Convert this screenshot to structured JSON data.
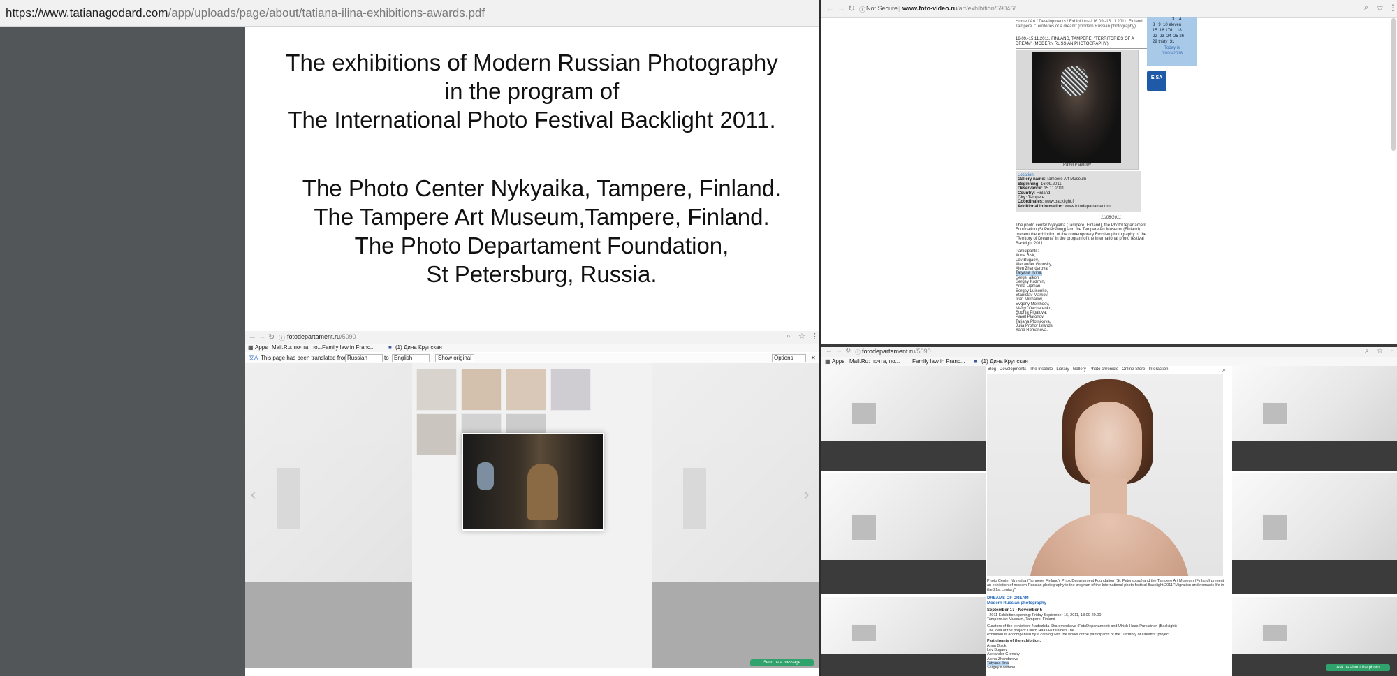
{
  "left_window": {
    "url_host": "https://www.tatianagodard.com",
    "url_path": "/app/uploads/page/about/tatiana-ilina-exhibitions-awards.pdf",
    "pdf_lines": [
      "The exhibitions of Modern Russian Photography",
      "in the program of",
      "The International Photo Festival Backlight 2011.",
      "The Photo Center Nykyaika, Tampere, Finland.",
      "The Tampere Art Museum,Tampere, Finland.",
      "The Photo Departament Foundation,",
      "St Petersburg, Russia."
    ]
  },
  "bottom_left_window": {
    "url_host": "fotodepartament.ru",
    "url_path": "/5090",
    "bookmarks": [
      "Apps",
      "Mail.Ru: почта, по...",
      "Family law in Franc...",
      "(1) Дина Крупская"
    ],
    "translate": {
      "message": "This page has been translated from",
      "from_lang": "Russian",
      "to_word": "to",
      "to_lang": "English",
      "show_original": "Show original",
      "options": "Options"
    },
    "send_message": "Send us a message"
  },
  "top_right_window": {
    "not_secure": "Not Secure",
    "url_host": "www.foto-video.ru",
    "url_path": "/art/exhibition/59046/",
    "breadcrumb": "Home / Art / Developments / Exhibitions / 16.09.-15.11.2011. Finland, Tampere. \"Territories of a dream\" (modern Russian photography)",
    "headline": "16.09.-15.11.2011. FINLAND, TAMPERE. \"TERRITORIES OF A DREAM\" (MODERN RUSSIAN PHOTOGRAPHY)",
    "photo_caption": "Pavel Platonov",
    "location": {
      "heading": "Location",
      "rows": [
        {
          "k": "Gallery name:",
          "v": "Tampere Art Museum"
        },
        {
          "k": "Beginning:",
          "v": "16.09.2011"
        },
        {
          "k": "Deservance:",
          "v": "15.11.2011"
        },
        {
          "k": "Country:",
          "v": "Finland"
        },
        {
          "k": "City:",
          "v": "Tampere"
        },
        {
          "k": "Coordinates:",
          "v": "www.backlight.fi"
        },
        {
          "k": "Additional information:",
          "v": "www.fotodepartament.ru"
        }
      ]
    },
    "date": "11/08/2011",
    "description": "The photo center Nykyaika (Tampere, Finland), the PhotoDepartament Foundation (St.Petersburg) and the Tampere Art Museum (Finland) present the exhibition of the contemporary Russian photography of the \"Territory of Dreams\" in the program of the international photo festival Backlight 2011.",
    "participants_label": "Participants:",
    "participants": [
      "Anna Bisk,",
      "Lev Bugaev,",
      "Alexander Gronsky,",
      "Alen Zhandarova,",
      "Tatyana Ilyina,",
      "Sergei alkon",
      "Sergey Kozmin,",
      "Anna Lipman,",
      "Sergey Luisenko,",
      "Stanislav Markov,",
      "Ivan Mikhailov,",
      "Evgeny Molkhoev,",
      "Margo Ovcharenko,",
      "Sophia Pigalova,",
      "Pavel Platonov,",
      "Tatiana Plotnikova,",
      "Julia Prohor Islands,",
      "Yana Romanova."
    ],
    "calendar_rows": [
      [
        "",
        "",
        "",
        "3",
        "4"
      ],
      [
        "8",
        "9",
        "10 eleven",
        ""
      ],
      [
        "15",
        "16 17th",
        "18"
      ],
      [
        "22",
        "23",
        "24",
        "25 26"
      ],
      [
        "29 thirty",
        "31"
      ]
    ],
    "today": "Today is",
    "today_date": "01/03/2018",
    "eisa": "EISA"
  },
  "bottom_right_window": {
    "url_host": "fotodepartament.ru",
    "url_path": "/5090",
    "bookmarks": [
      "Apps",
      "Mail.Ru: почта, по...",
      "Family law in Franc...",
      "(1) Дина Крупская"
    ],
    "site_nav": [
      "Blog",
      "Developments",
      "The Institute",
      "Library",
      "Gallery",
      "Photo chronicle",
      "Online Store",
      "Interaction"
    ],
    "caption": "Photo Center Nykyaika (Tampere, Finland), PhotoDepartament Foundation (St. Petersburg) and the Tampere Art Museum (Finland) present an exhibition of modern Russian photography in the program of the International photo festival Backlight 2011 \"Migration and nomadic life in the 21st century\"",
    "title_line1": "DREAMS OF DREAM",
    "title_line2": "Modern Russian photography",
    "dates": "September 17 - November 5",
    "details": [
      "- 2011 Exhibition opening: Friday September 16, 2011, 18.00-20.00",
      "Tampere Art Museum, Tampere, Finland",
      "Curators of the exhibition: Nadezhda Sharomenkova (FotoDepartament) and Ulrich Haas-Pursiainen (Backlight)",
      "The idea of the project: Ulrich Haas-Pursiainen The",
      "exhibition is accompanied by a catalog with the works of the participants of the \"Territory of Dreams\" project"
    ],
    "participants_label": "Participants of the exhibition:",
    "participants": [
      "Anna Bisck",
      "Lev Bugaev",
      "Alexander Gronsky",
      "Alena Zhandarova",
      "Tatyana Ilina",
      "Sergey Kosmino"
    ],
    "ask_button": "Ask us about the photo"
  }
}
